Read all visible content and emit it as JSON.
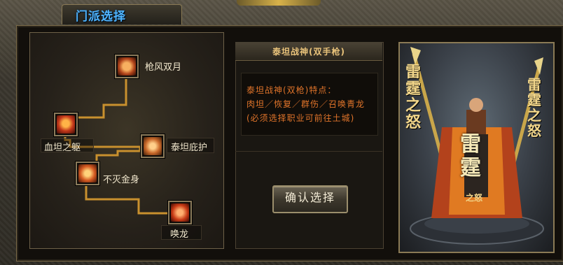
{
  "window": {
    "title": "门派选择"
  },
  "skill_tree": {
    "nodes": [
      {
        "id": "qiangfeng",
        "label": "枪风双月"
      },
      {
        "id": "xuetan",
        "label": "血坦之躯"
      },
      {
        "id": "taitan",
        "label": "泰坦庇护"
      },
      {
        "id": "bumie",
        "label": "不灭金身"
      },
      {
        "id": "huanlong",
        "label": "唤龙"
      }
    ]
  },
  "class_info": {
    "header": "泰坦战神(双手枪)",
    "lines": [
      "泰坦战神(双枪)特点：",
      "肉坦／恢复／群伤／召唤青龙",
      "(必须选择职业可前往土城)"
    ]
  },
  "confirm_label": "确认选择",
  "colors": {
    "title": "#4fb4ff",
    "desc_text": "#e0742a",
    "header_text": "#e8c27a",
    "connector": "#c8902e"
  },
  "preview": {
    "weapon_glyphs_left": "雷霆之怒",
    "weapon_glyphs_right": "雷霆之怒",
    "banner_text": "雷霆",
    "banner_sub": "之怒"
  }
}
